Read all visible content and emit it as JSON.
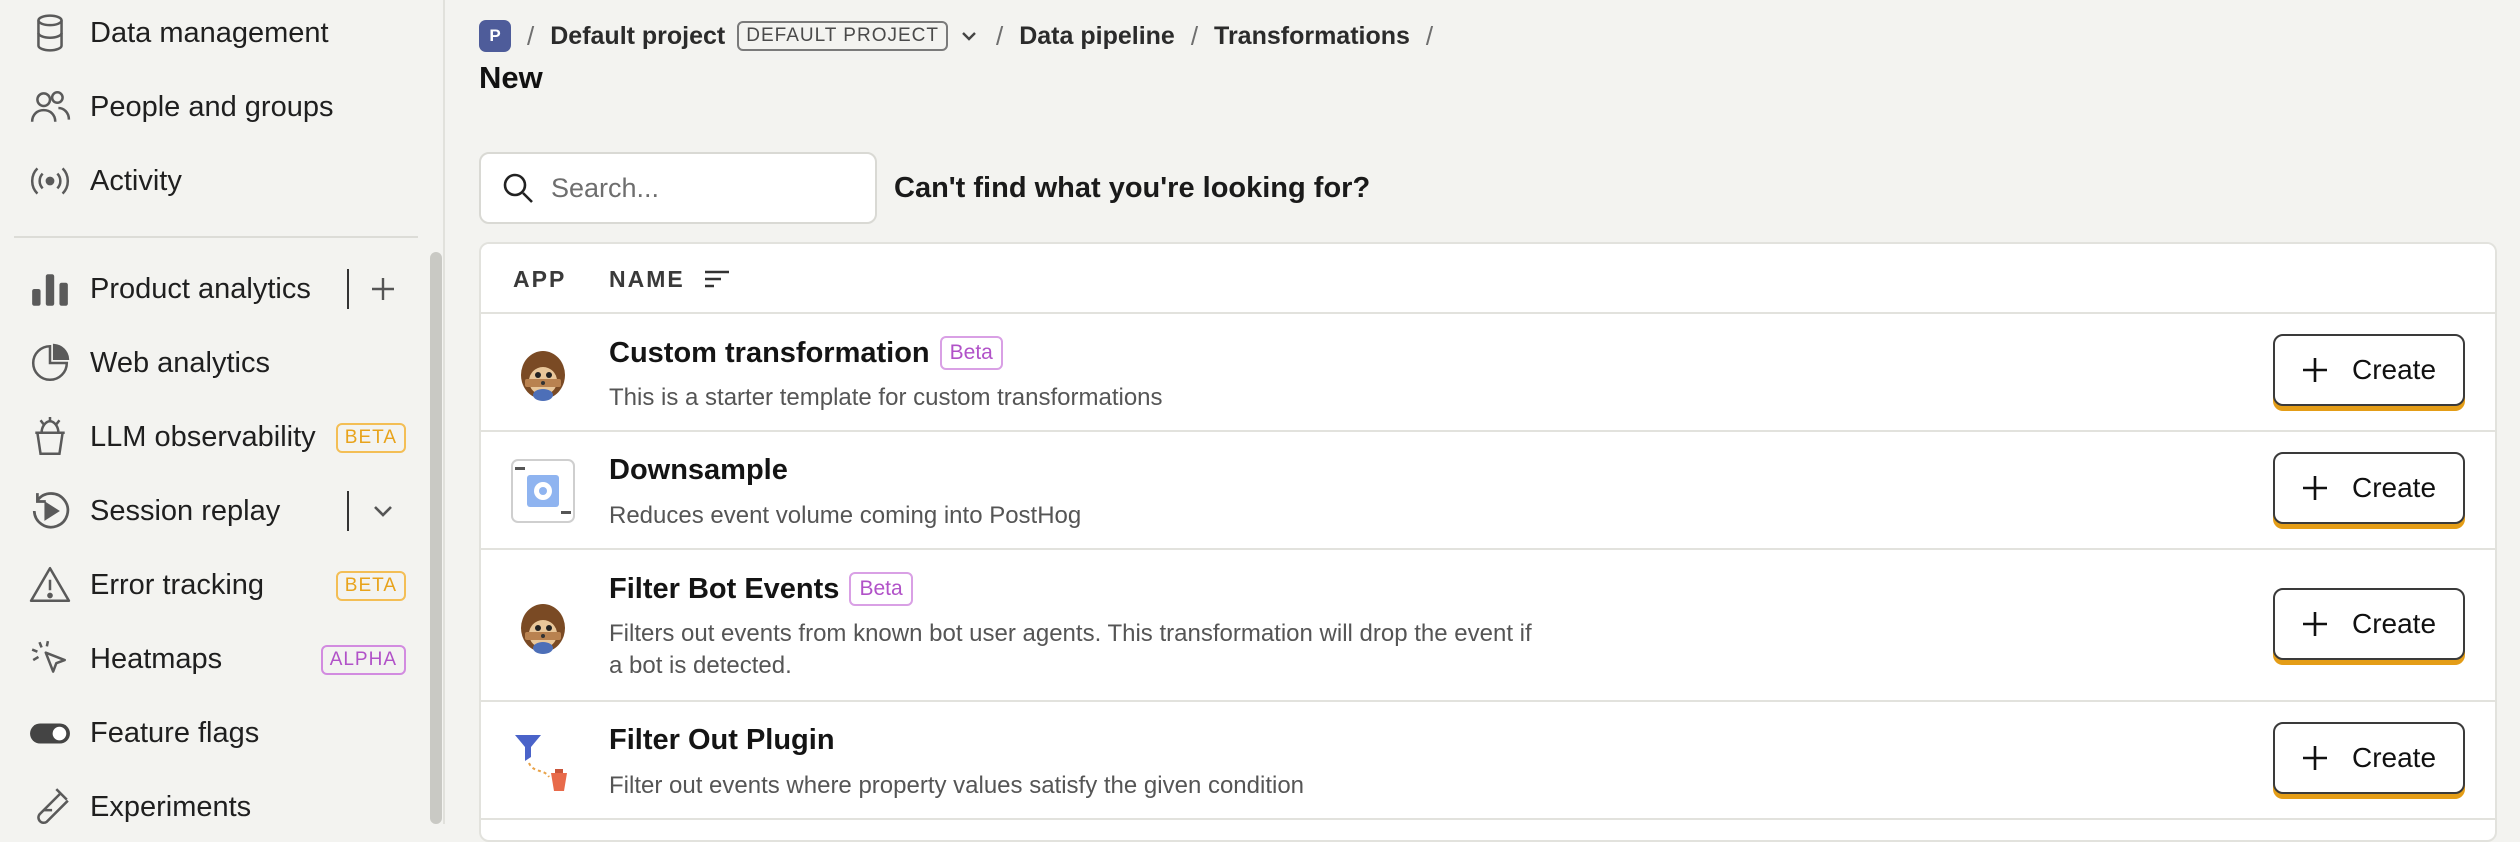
{
  "sidebar": {
    "items": [
      {
        "label": "Data management",
        "icon": "database-icon"
      },
      {
        "label": "People and groups",
        "icon": "people-icon"
      },
      {
        "label": "Activity",
        "icon": "broadcast-icon"
      },
      {
        "label": "Product analytics",
        "icon": "bar-chart-icon"
      },
      {
        "label": "Web analytics",
        "icon": "pie-chart-icon"
      },
      {
        "label": "LLM observability",
        "icon": "hedgehog-cup-icon",
        "badge": "BETA"
      },
      {
        "label": "Session replay",
        "icon": "replay-icon"
      },
      {
        "label": "Error tracking",
        "icon": "warning-icon",
        "badge": "BETA"
      },
      {
        "label": "Heatmaps",
        "icon": "cursor-click-icon",
        "badge": "ALPHA"
      },
      {
        "label": "Feature flags",
        "icon": "toggle-icon"
      },
      {
        "label": "Experiments",
        "icon": "flask-icon"
      }
    ]
  },
  "breadcrumb": {
    "project_initial": "P",
    "project": "Default project",
    "project_tag": "DEFAULT PROJECT",
    "separator": "/",
    "pipeline": "Data pipeline",
    "section": "Transformations"
  },
  "page": {
    "title": "New",
    "search_placeholder": "Search...",
    "cant_find": "Can't find what you're looking for?"
  },
  "table": {
    "headers": {
      "app": "APP",
      "name": "NAME"
    },
    "create_label": "Create",
    "rows": [
      {
        "title": "Custom transformation",
        "tag": "Beta",
        "desc": "This is a starter template for custom transformations",
        "icon": "hedgehog-icon"
      },
      {
        "title": "Downsample",
        "tag": "",
        "desc": "Reduces event volume coming into PostHog",
        "icon": "downsample-gear-icon"
      },
      {
        "title": "Filter Bot Events",
        "tag": "Beta",
        "desc": "Filters out events from known bot user agents. This transformation will drop the event if a bot is detected.",
        "icon": "hedgehog-icon"
      },
      {
        "title": "Filter Out Plugin",
        "tag": "",
        "desc": "Filter out events where property values satisfy the given condition",
        "icon": "funnel-bucket-icon"
      }
    ]
  },
  "colors": {
    "accent_orange": "#e49d17",
    "beta_purple": "#b152c8",
    "badge_beta_orange": "#e8a31b",
    "project_avatar": "#4e5c9a"
  }
}
